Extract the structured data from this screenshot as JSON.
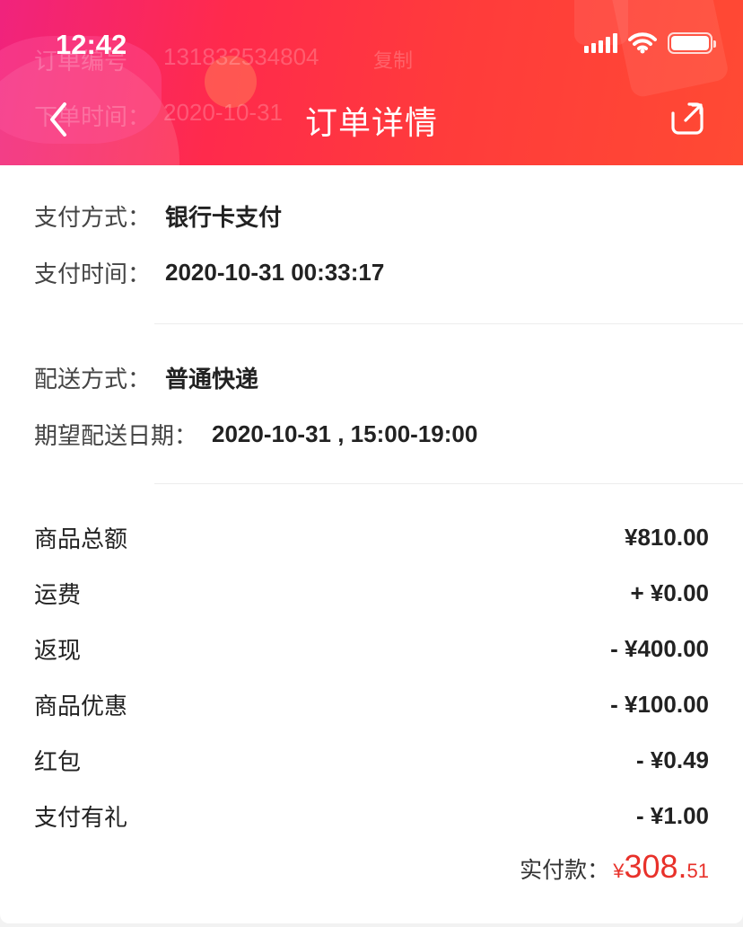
{
  "status_bar": {
    "time": "12:42"
  },
  "header": {
    "title": "订单详情",
    "ghost": {
      "order_label": "订单编号",
      "order_no": "131832534804",
      "copy": "复制",
      "time_label": "下单时间：",
      "time_value": "2020-10-31"
    }
  },
  "payment": {
    "method_label": "支付方式：",
    "method_value": "银行卡支付",
    "time_label": "支付时间：",
    "time_value": "2020-10-31 00:33:17"
  },
  "delivery": {
    "method_label": "配送方式：",
    "method_value": "普通快递",
    "date_label": "期望配送日期：",
    "date_value": "2020-10-31 , 15:00-19:00"
  },
  "summary": [
    {
      "label": "商品总额",
      "value": "¥810.00"
    },
    {
      "label": "运费",
      "value": "+ ¥0.00"
    },
    {
      "label": "返现",
      "value": "- ¥400.00"
    },
    {
      "label": "商品优惠",
      "value": "- ¥100.00"
    },
    {
      "label": "红包",
      "value": "- ¥0.49"
    },
    {
      "label": "支付有礼",
      "value": "- ¥1.00"
    }
  ],
  "total": {
    "label": "实付款：",
    "currency": "¥",
    "integer": "308.",
    "decimal": "51"
  },
  "colors": {
    "header_start": "#f0237d",
    "header_end": "#ff4a33",
    "total_red": "#e8312a"
  },
  "icons": {
    "back": "chevron-left-icon",
    "share": "share-icon",
    "signal": "signal-icon",
    "wifi": "wifi-icon",
    "battery": "battery-icon"
  }
}
